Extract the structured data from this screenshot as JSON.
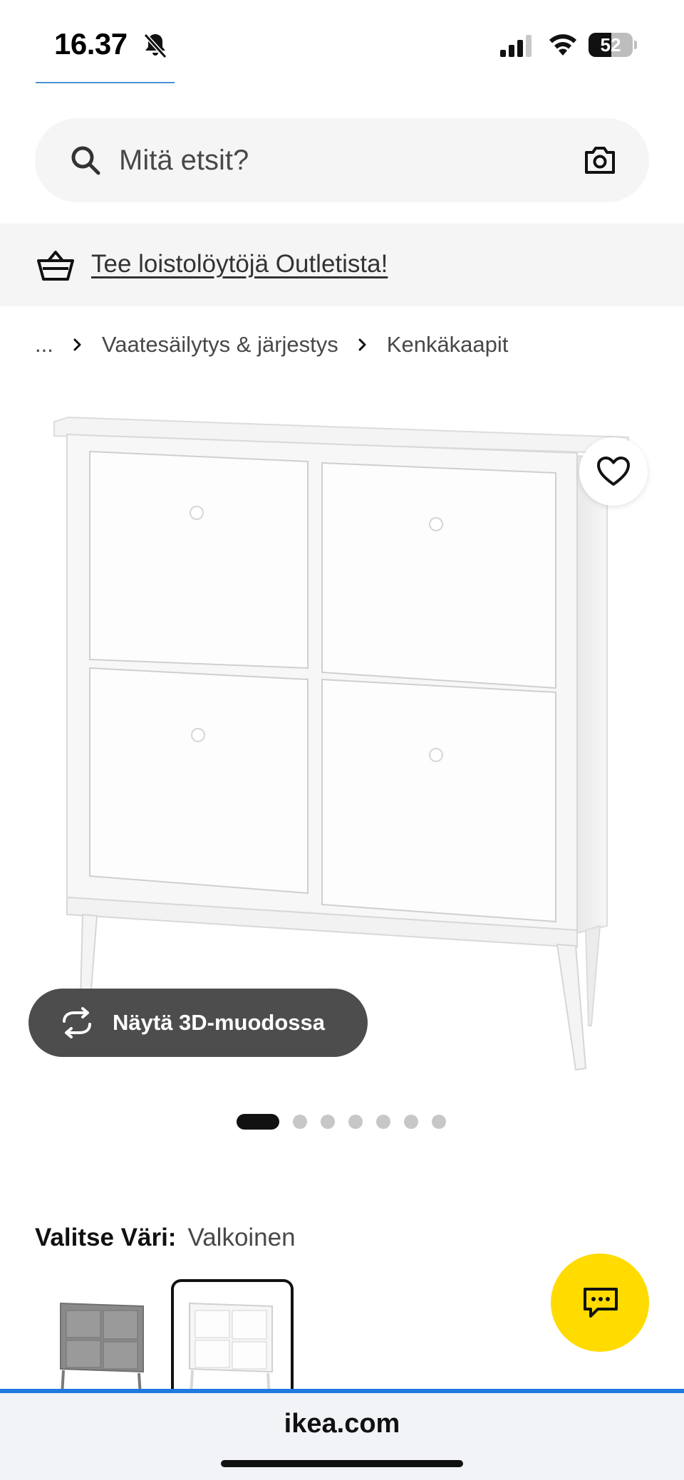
{
  "status_bar": {
    "time": "16.37",
    "battery_percent": 52,
    "battery_label": "52",
    "icons": [
      "bell-slash-icon",
      "cellular-signal-icon",
      "wifi-icon",
      "battery-icon"
    ]
  },
  "search": {
    "placeholder": "Mitä etsit?",
    "icons": [
      "search-icon",
      "camera-icon"
    ]
  },
  "promo": {
    "link_text": "Tee loistolöytöjä Outletista!",
    "icon": "basket-icon"
  },
  "breadcrumb": {
    "items": [
      "...",
      "Vaatesäilytys & järjestys",
      "Kenkäkaapit"
    ]
  },
  "product": {
    "wishlist_icon": "heart-icon",
    "view_3d_label": "Näytä 3D-muodossa",
    "carousel": {
      "total": 7,
      "active_index": 0
    }
  },
  "color": {
    "label": "Valitse Väri:",
    "selected": "Valkoinen",
    "swatches": [
      {
        "name": "grey",
        "color": "#8c8c8c",
        "selected": false
      },
      {
        "name": "white",
        "color": "#ffffff",
        "selected": true
      }
    ]
  },
  "chat": {
    "icon": "chat-icon",
    "color": "#ffdb00"
  },
  "browser": {
    "url": "ikea.com",
    "accent": "#1f7ae0"
  }
}
